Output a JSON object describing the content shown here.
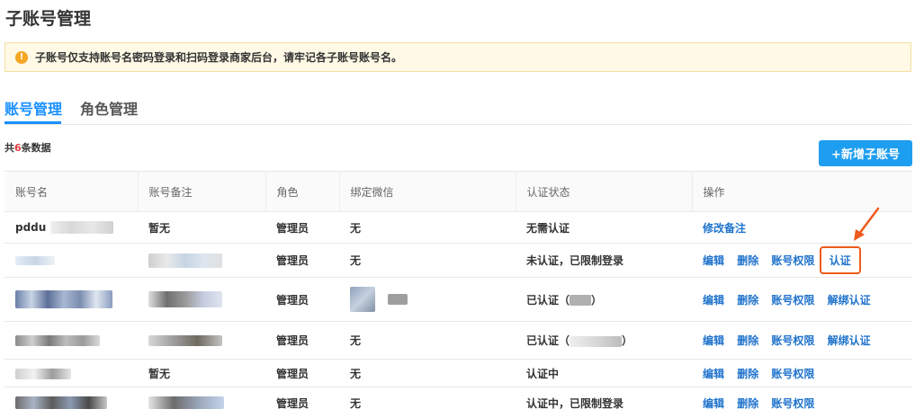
{
  "page": {
    "title": "子账号管理"
  },
  "notice": {
    "text": "子账号仅支持账号名密码登录和扫码登录商家后台，请牢记各子账号账号名。"
  },
  "tabs": [
    {
      "label": "账号管理",
      "active": true
    },
    {
      "label": "角色管理",
      "active": false
    }
  ],
  "summary": {
    "prefix": "共",
    "count": "6",
    "suffix": "条数据"
  },
  "add_button": {
    "label": "+新增子账号"
  },
  "table": {
    "headers": [
      "账号名",
      "账号备注",
      "角色",
      "绑定微信",
      "认证状态",
      "操作"
    ],
    "rows": [
      {
        "account": "pddu",
        "remark": "暂无",
        "role": "管理员",
        "wechat": "无",
        "status": "无需认证",
        "actions": [
          "修改备注"
        ]
      },
      {
        "account": "",
        "remark": "",
        "role": "管理员",
        "wechat": "无",
        "status": "未认证，已限制登录",
        "actions": [
          "编辑",
          "删除",
          "账号权限",
          "认证"
        ]
      },
      {
        "account": "",
        "remark": "",
        "role": "管理员",
        "wechat": "",
        "status_prefix": "已认证（",
        "status_suffix": "）",
        "actions": [
          "编辑",
          "删除",
          "账号权限",
          "解绑认证"
        ]
      },
      {
        "account": "",
        "remark": "",
        "role": "管理员",
        "wechat": "无",
        "status_prefix": "已认证（",
        "status_suffix": "）",
        "actions": [
          "编辑",
          "删除",
          "账号权限",
          "解绑认证"
        ]
      },
      {
        "account": "",
        "remark": "暂无",
        "role": "管理员",
        "wechat": "无",
        "status": "认证中",
        "actions": [
          "编辑",
          "删除",
          "账号权限"
        ]
      },
      {
        "account": "",
        "remark": "",
        "role": "管理员",
        "wechat": "无",
        "status": "认证中，已限制登录",
        "actions": [
          "编辑",
          "删除",
          "账号权限"
        ]
      }
    ]
  },
  "colors": {
    "accent": "#1890ff",
    "link": "#1f73cc",
    "danger": "#e4393c",
    "highlight": "#ee5b1b"
  },
  "icons": {
    "notice": "warning-icon",
    "pointer": "arrow-icon"
  }
}
